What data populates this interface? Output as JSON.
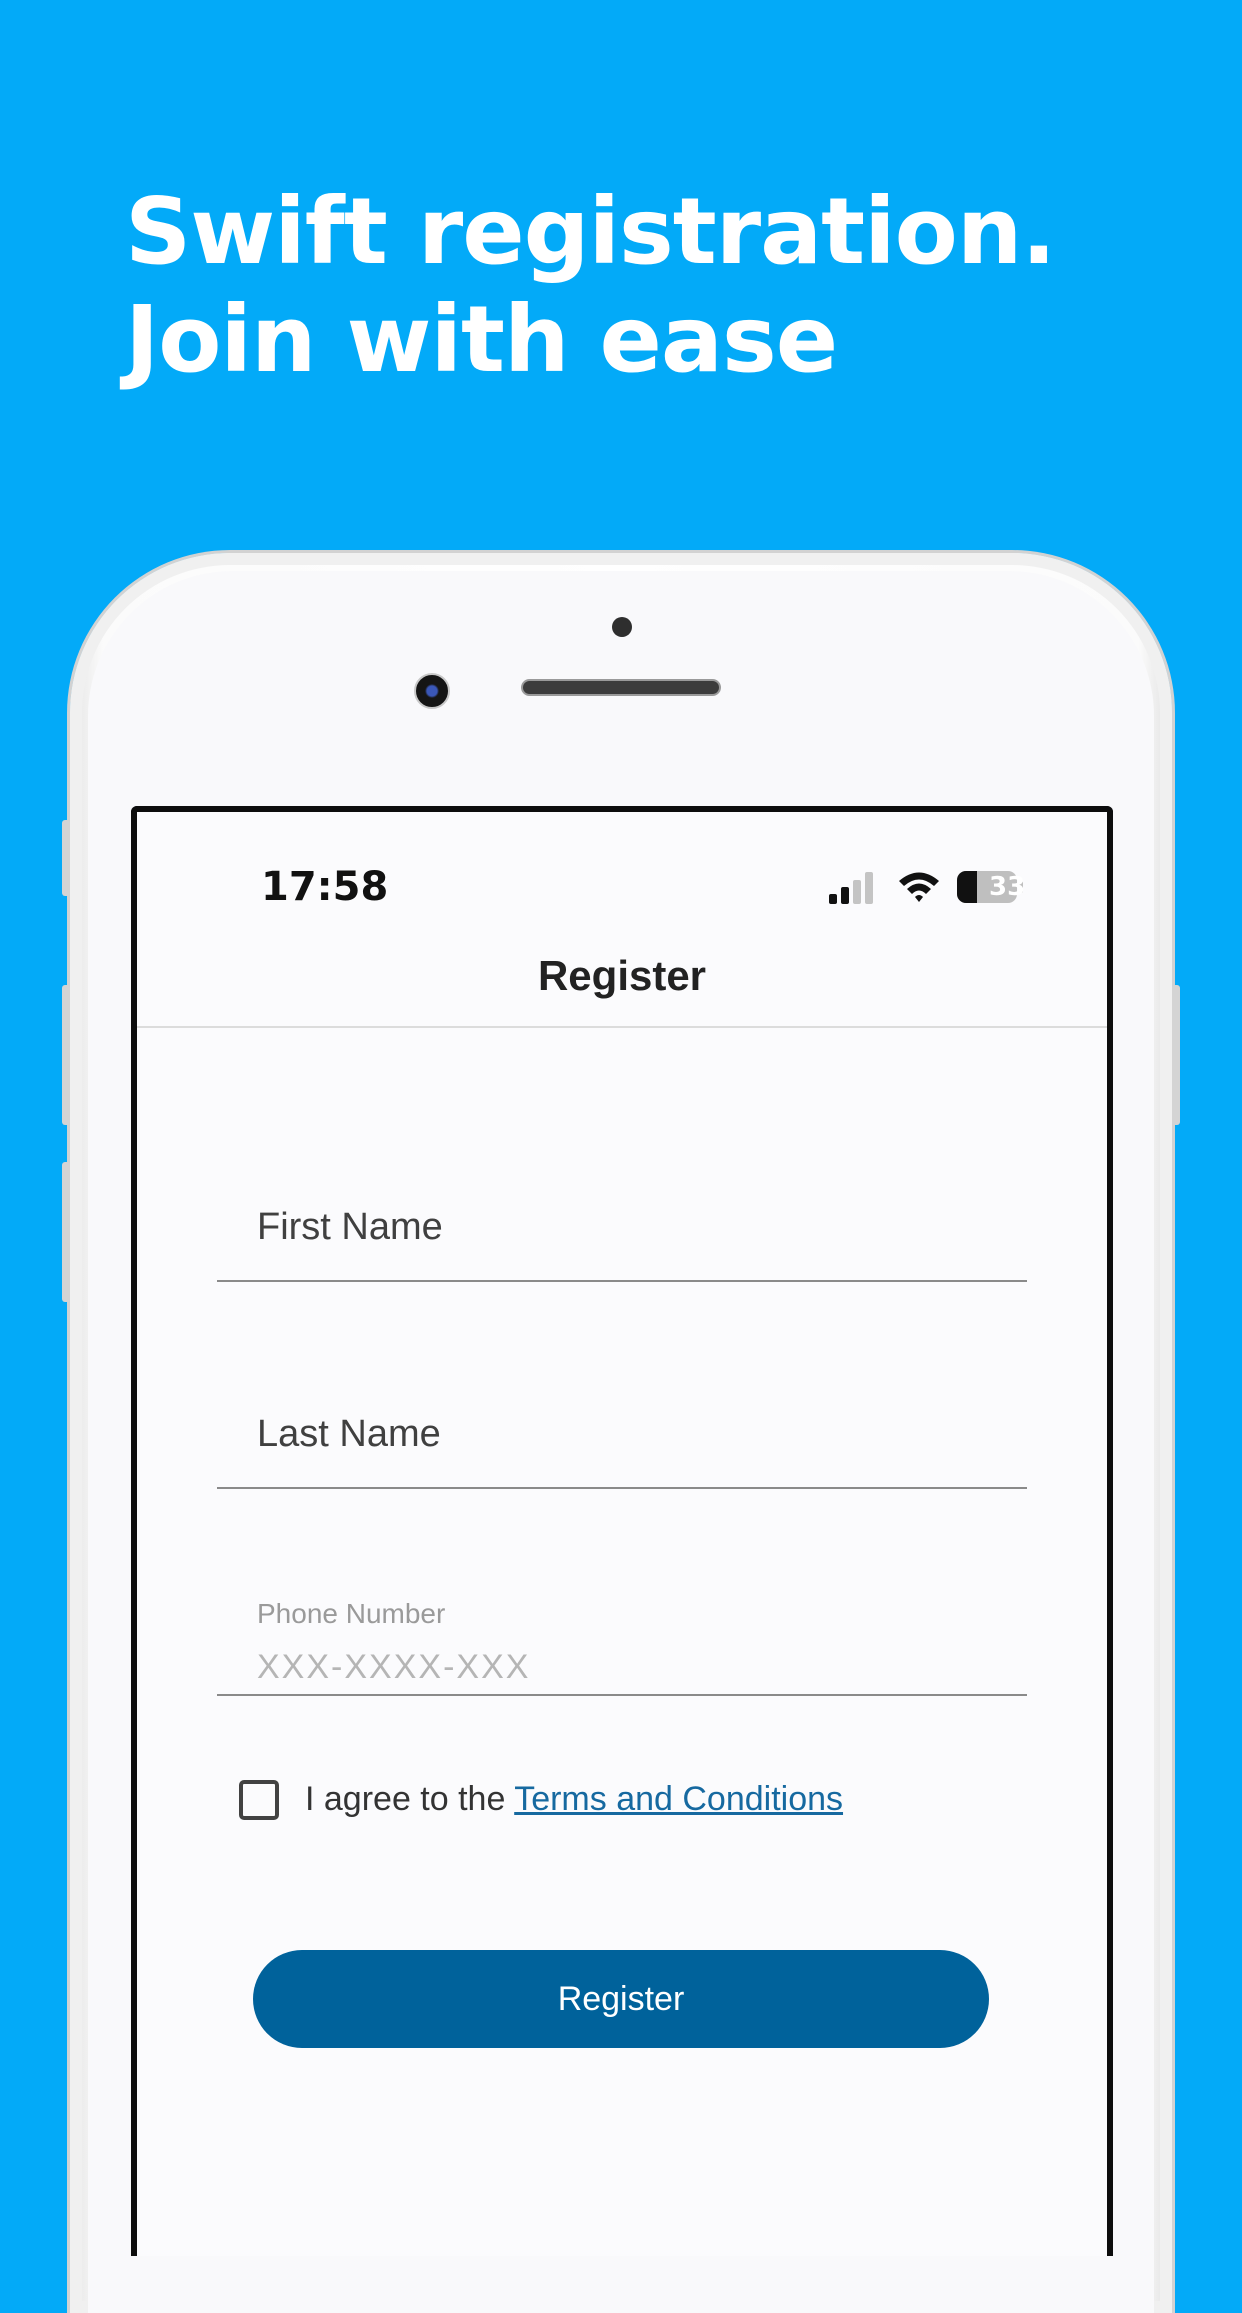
{
  "headline": "Swift registration. Join with ease",
  "status_bar": {
    "time": "17:58",
    "battery_level": "33"
  },
  "nav": {
    "title": "Register"
  },
  "form": {
    "first_name": {
      "placeholder": "First Name"
    },
    "last_name": {
      "placeholder": "Last Name"
    },
    "phone": {
      "label": "Phone Number",
      "placeholder": "XXX-XXXX-XXX"
    },
    "agree_text": "I agree to the ",
    "terms_link": "Terms and Conditions",
    "checkbox_checked": false,
    "submit_label": "Register"
  },
  "colors": {
    "background": "#03aaf8",
    "primary_button": "#00629b",
    "link": "#1669a0"
  },
  "icons": [
    "signal-icon",
    "wifi-icon",
    "battery-icon",
    "checkbox-icon"
  ]
}
